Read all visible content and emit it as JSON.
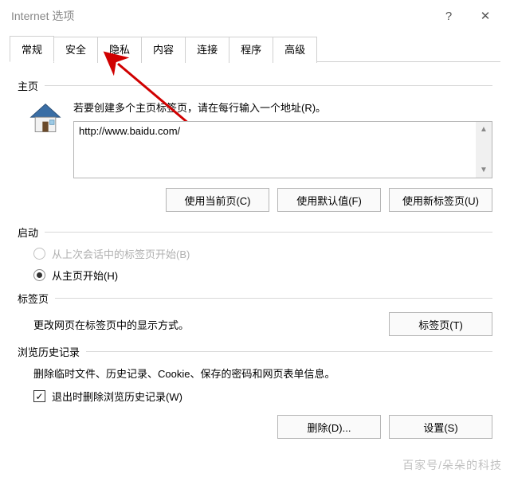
{
  "window": {
    "title": "Internet 选项",
    "help_glyph": "?",
    "close_glyph": "✕"
  },
  "tabs": [
    {
      "label": "常规",
      "active": true
    },
    {
      "label": "安全",
      "active": false
    },
    {
      "label": "隐私",
      "active": false
    },
    {
      "label": "内容",
      "active": false
    },
    {
      "label": "连接",
      "active": false
    },
    {
      "label": "程序",
      "active": false
    },
    {
      "label": "高级",
      "active": false
    }
  ],
  "home": {
    "heading": "主页",
    "desc": "若要创建多个主页标签页，请在每行输入一个地址(R)。",
    "url": "http://www.baidu.com/",
    "buttons": {
      "current": "使用当前页(C)",
      "default": "使用默认值(F)",
      "newtab": "使用新标签页(U)"
    }
  },
  "startup": {
    "heading": "启动",
    "option_last_session": "从上次会话中的标签页开始(B)",
    "option_home": "从主页开始(H)",
    "selected": "home"
  },
  "tabpage": {
    "heading": "标签页",
    "desc": "更改网页在标签页中的显示方式。",
    "button": "标签页(T)"
  },
  "history": {
    "heading": "浏览历史记录",
    "desc": "删除临时文件、历史记录、Cookie、保存的密码和网页表单信息。",
    "checkbox_label": "退出时删除浏览历史记录(W)",
    "checked": true,
    "check_glyph": "✓",
    "buttons": {
      "delete": "删除(D)...",
      "settings": "设置(S)"
    }
  },
  "watermark": "百家号/朵朵的科技"
}
